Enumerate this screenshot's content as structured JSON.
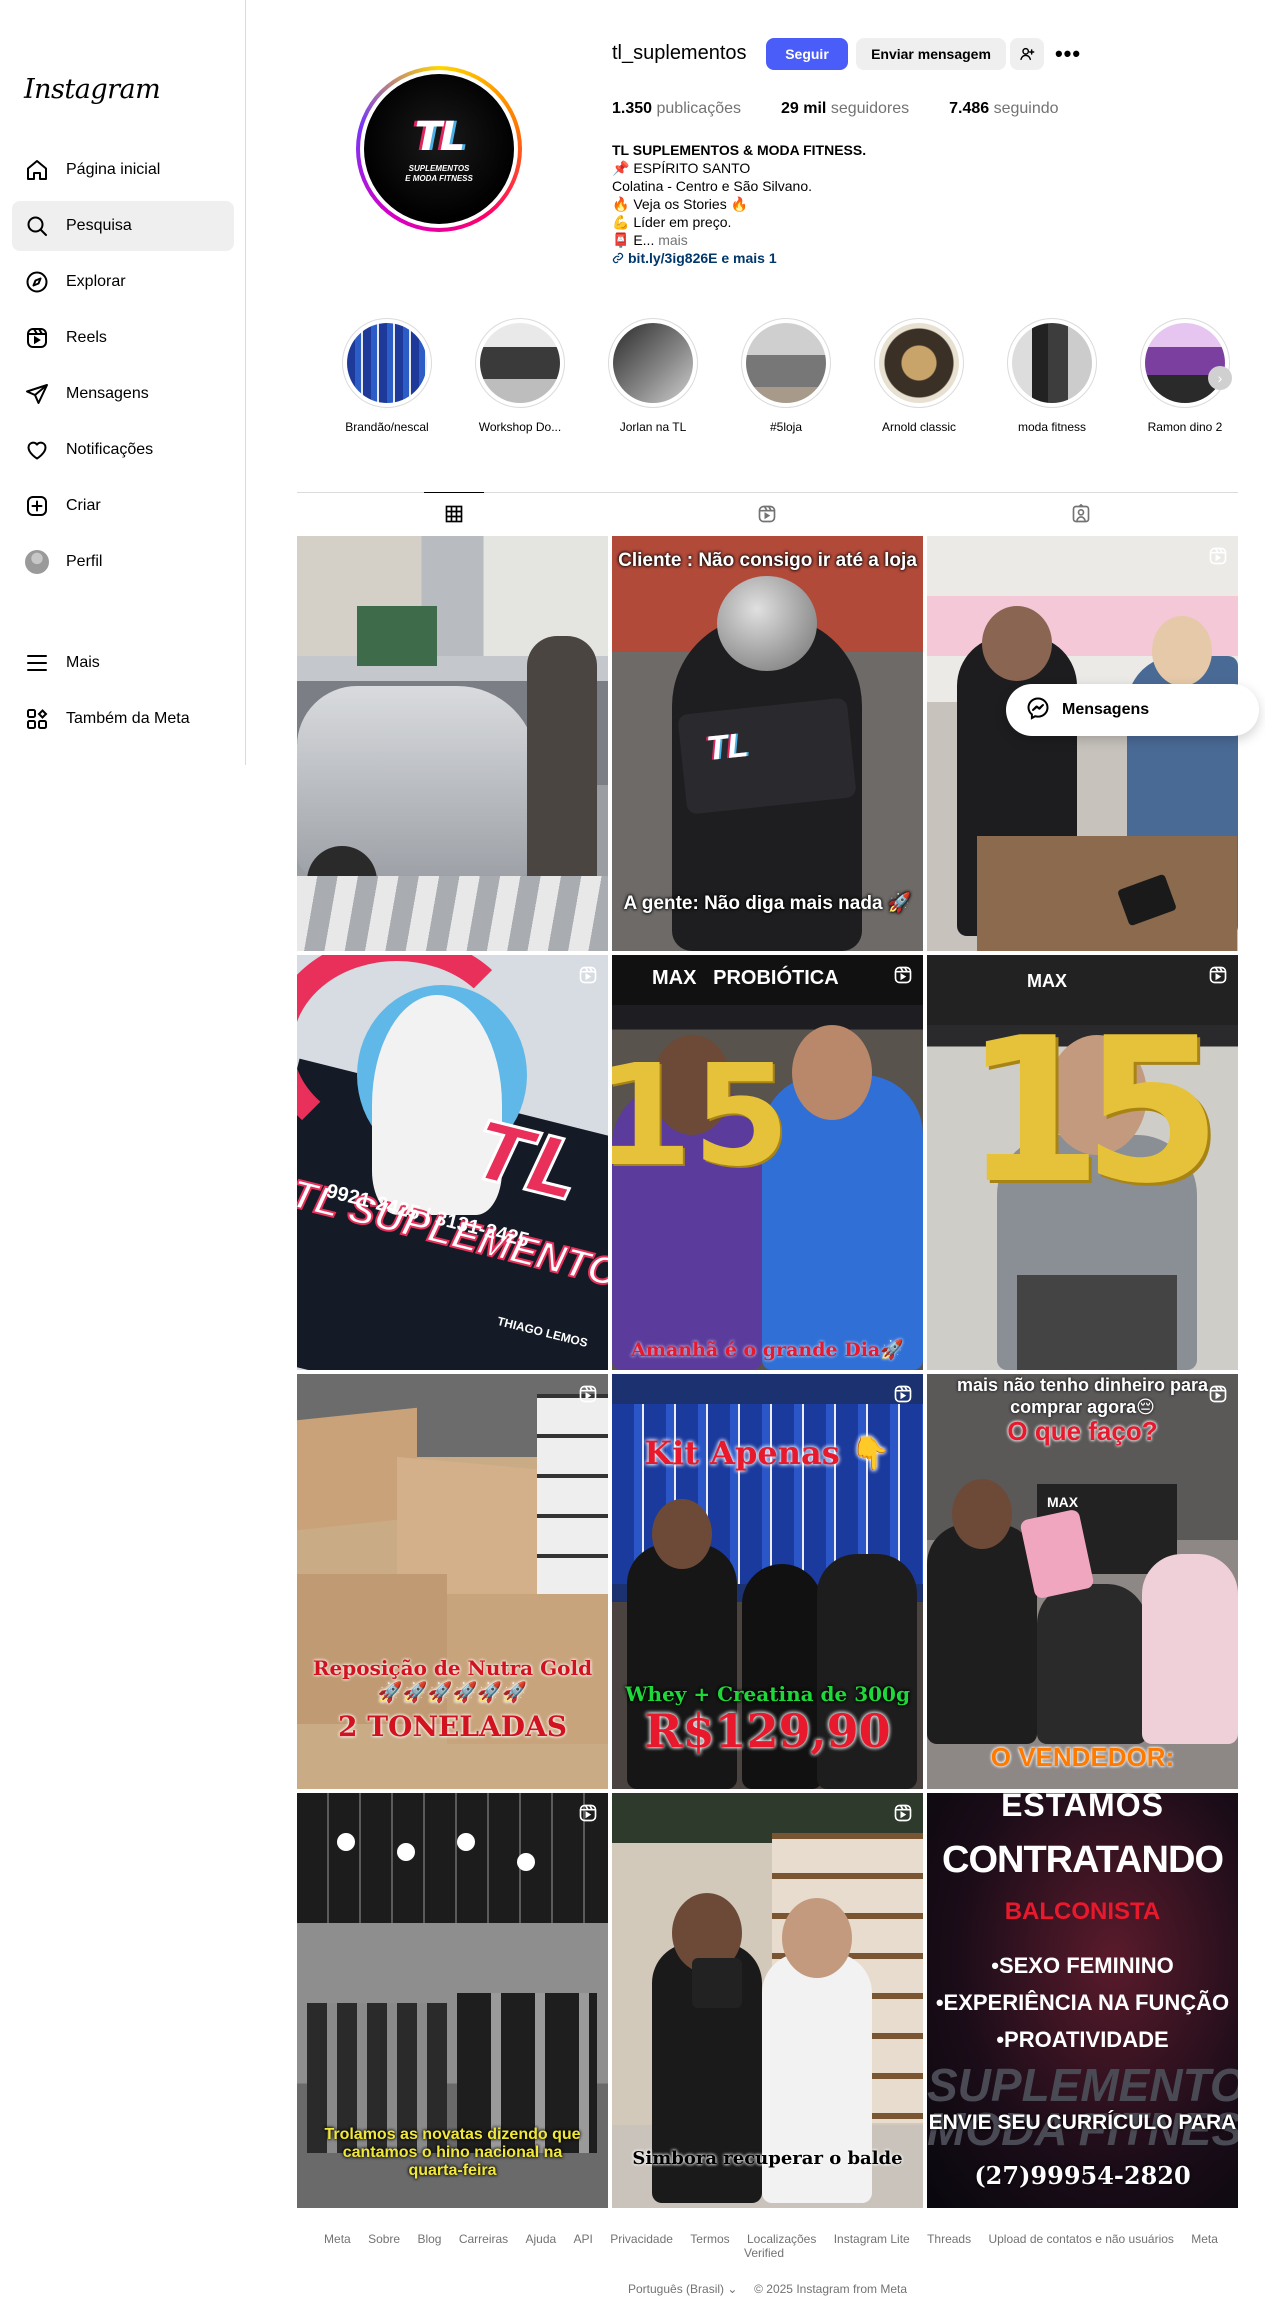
{
  "app": {
    "logo": "Instagram"
  },
  "sidebar": {
    "items": [
      {
        "label": "Página inicial",
        "icon": "home-icon"
      },
      {
        "label": "Pesquisa",
        "icon": "search-icon",
        "active": true
      },
      {
        "label": "Explorar",
        "icon": "compass-icon"
      },
      {
        "label": "Reels",
        "icon": "reels-icon"
      },
      {
        "label": "Mensagens",
        "icon": "send-icon"
      },
      {
        "label": "Notificações",
        "icon": "heart-icon"
      },
      {
        "label": "Criar",
        "icon": "plus-icon"
      },
      {
        "label": "Perfil",
        "icon": "avatar"
      }
    ],
    "bottom": [
      {
        "label": "Mais",
        "icon": "menu-icon"
      },
      {
        "label": "Também da Meta",
        "icon": "meta-grid-icon"
      }
    ]
  },
  "profile": {
    "username": "tl_suplementos",
    "pic_text": "TL",
    "pic_subtext_1": "SUPLEMENTOS",
    "pic_subtext_2": "E MODA FITNESS",
    "follow_label": "Seguir",
    "message_label": "Enviar mensagem",
    "more_label": "•••",
    "stats": [
      {
        "count": "1.350",
        "label": "publicações"
      },
      {
        "count": "29 mil",
        "label": "seguidores"
      },
      {
        "count": "7.486",
        "label": "seguindo"
      }
    ],
    "bio": {
      "name": "TL SUPLEMENTOS & MODA FITNESS.",
      "lines": [
        "📌 ESPÍRITO SANTO",
        "Colatina - Centro e São Silvano.",
        "🔥 Veja os Stories 🔥",
        "💪 Líder em preço.",
        "📮 E..."
      ],
      "more": "mais",
      "link": "bit.ly/3ig826E e mais 1"
    }
  },
  "highlights": [
    {
      "label": "Brandão/nescal",
      "color": "#2a3f8f"
    },
    {
      "label": "Workshop Do...",
      "color": "#8a8a8a"
    },
    {
      "label": "Jorlan na TL",
      "color": "#6d6d6d"
    },
    {
      "label": "#5loja",
      "color": "#a0a0a0"
    },
    {
      "label": "Arnold classic",
      "color": "#3a3025"
    },
    {
      "label": "moda fitness",
      "color": "#4a4a4a"
    },
    {
      "label": "Ramon dino 2",
      "color": "#7b3fa0"
    }
  ],
  "tabs": [
    {
      "name": "posts",
      "icon": "grid-icon",
      "active": true
    },
    {
      "name": "reels",
      "icon": "reels-icon"
    },
    {
      "name": "tagged",
      "icon": "tagged-icon"
    }
  ],
  "posts": [
    {
      "overlay_top": "",
      "overlay_bottom": "",
      "reel": false,
      "bg": "#8f9197"
    },
    {
      "overlay_top": "Cliente : Não consigo ir até a loja",
      "overlay_bottom": "A gente: Não diga mais nada 🚀",
      "reel": false,
      "bg": "#5a4a46"
    },
    {
      "overlay_top": "",
      "overlay_bottom": "",
      "reel": true,
      "bg": "#c9c6c2"
    },
    {
      "overlay_top": "",
      "overlay_bottom": "",
      "reel": true,
      "bg": "#1c2430",
      "sign": "TL SUPLEMENTOS",
      "sign_phone": "9921-2425 | 3131-2425",
      "sign_fb": "THIAGO LEMOS"
    },
    {
      "overlay_top": "",
      "overlay_bottom": "Amanhã é o grande Dia🚀",
      "reel": true,
      "bg": "#3b3a3e",
      "big_num": "15"
    },
    {
      "overlay_top": "",
      "overlay_bottom": "",
      "reel": true,
      "bg": "#b9b6b0",
      "big_num": "15"
    },
    {
      "overlay_top": "",
      "overlay_bottom": "Reposição de Nutra Gold 🚀🚀🚀🚀🚀🚀",
      "overlay_bottom2": "2 TONELADAS",
      "reel": true,
      "bg": "#b79a74"
    },
    {
      "overlay_top": "Kit Apenas 👇",
      "overlay_bottom": "Whey + Creatina de 300g",
      "overlay_bottom2": "R$129,90",
      "reel": true,
      "bg": "#263a66"
    },
    {
      "overlay_top": "mais não tenho dinheiro para comprar agora😔",
      "overlay_top2": "O que faço?",
      "overlay_bottom": "O VENDEDOR:",
      "reel": true,
      "bg": "#6f6a6a"
    },
    {
      "overlay_top": "",
      "overlay_bottom": "Trolamos as novatas dizendo que cantamos o hino nacional na quarta-feira",
      "reel": true,
      "bg": "#6a6a6a"
    },
    {
      "overlay_top": "",
      "overlay_bottom": "Simbora recuperar o balde",
      "reel": true,
      "bg": "#8a7f73"
    },
    {
      "overlay_top": "ESTAMOS",
      "overlay_top2": "CONTRATANDO",
      "overlay_role": "BALCONISTA",
      "overlay_list": [
        "•SEXO FEMININO",
        "•EXPERIÊNCIA NA FUNÇÃO",
        "•PROATIVIDADE"
      ],
      "overlay_bottom": "ENVIE SEU CURRÍCULO PARA",
      "overlay_bottom2": "(27)99954-2820",
      "reel": false,
      "bg": "#0a0a12"
    }
  ],
  "messages_pill": {
    "label": "Mensagens"
  },
  "footer": {
    "links": [
      "Meta",
      "Sobre",
      "Blog",
      "Carreiras",
      "Ajuda",
      "API",
      "Privacidade",
      "Termos",
      "Localizações",
      "Instagram Lite",
      "Threads",
      "Upload de contatos e não usuários",
      "Meta Verified"
    ],
    "language": "Português (Brasil)",
    "copyright": "© 2025 Instagram from Meta"
  }
}
